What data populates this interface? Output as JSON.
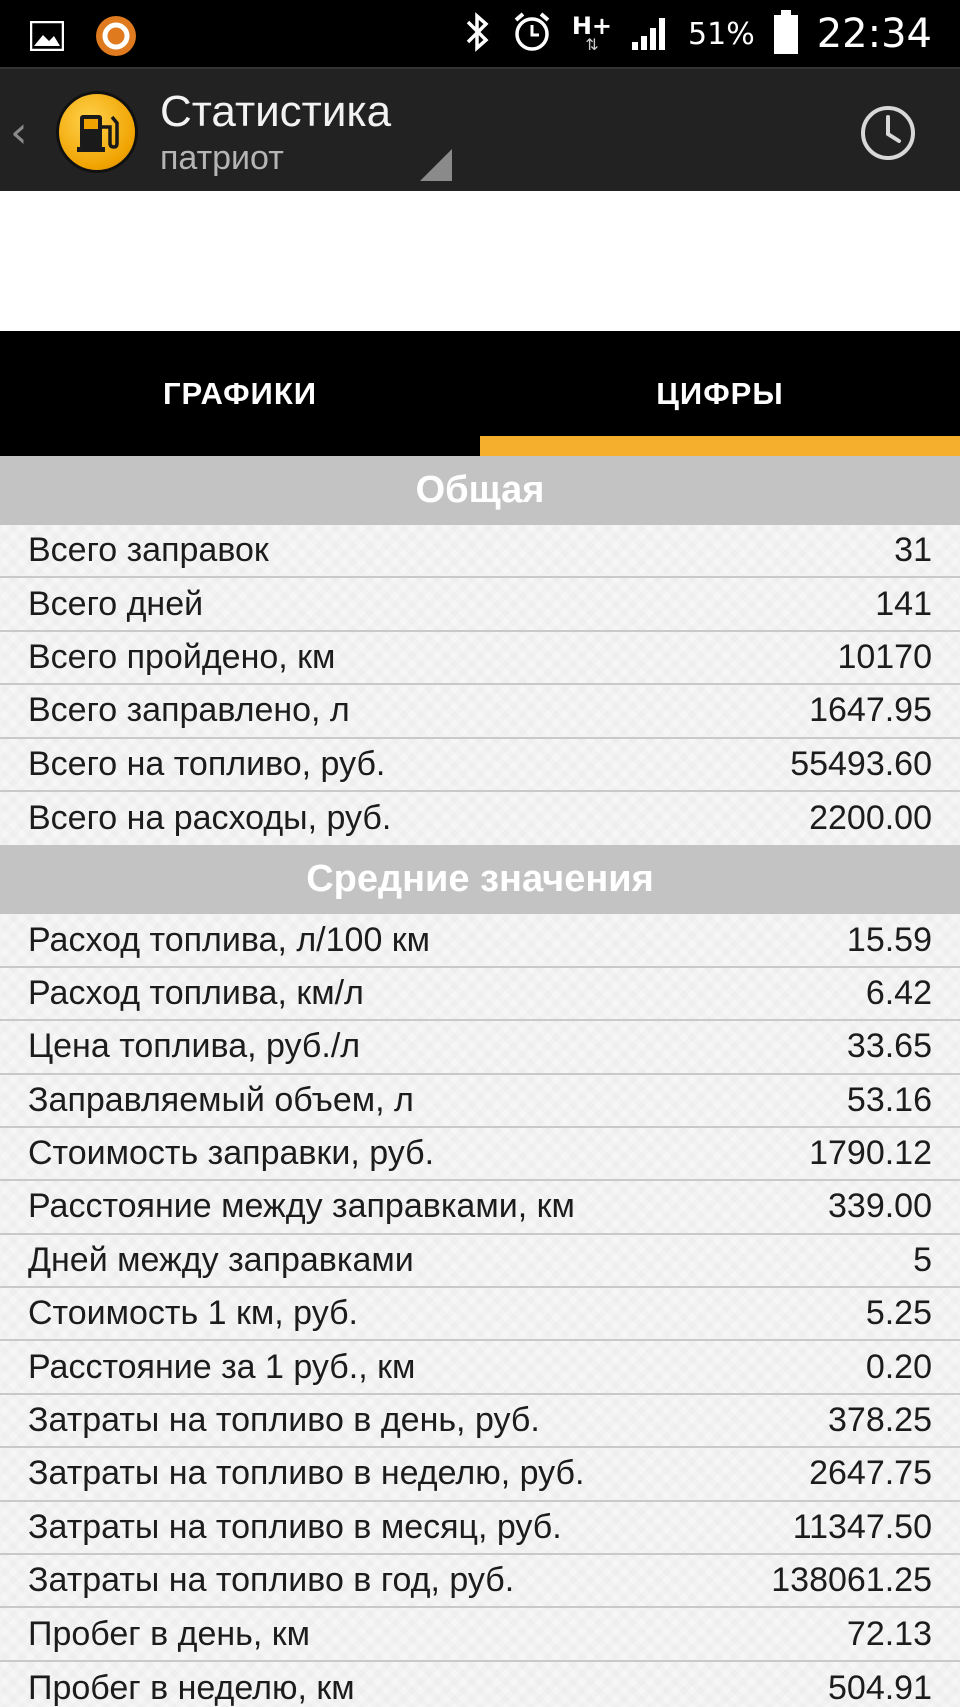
{
  "status_bar": {
    "network": "H+",
    "battery_percent": "51%",
    "time": "22:34",
    "icons": [
      "image-icon",
      "notification-app-icon",
      "bluetooth-icon",
      "alarm-icon",
      "network-h-plus-icon",
      "signal-icon",
      "battery-icon"
    ]
  },
  "action_bar": {
    "title": "Статистика",
    "subtitle": "патриот",
    "back_glyph": "‹",
    "accent": "#f6ae2d"
  },
  "tabs": [
    {
      "label": "ГРАФИКИ",
      "selected": false
    },
    {
      "label": "ЦИФРЫ",
      "selected": true
    }
  ],
  "sections": [
    {
      "title": "Общая",
      "rows": [
        {
          "label": "Всего заправок",
          "value": "31"
        },
        {
          "label": "Всего дней",
          "value": "141"
        },
        {
          "label": "Всего пройдено, км",
          "value": "10170"
        },
        {
          "label": "Всего заправлено, л",
          "value": "1647.95"
        },
        {
          "label": "Всего на топливо, руб.",
          "value": "55493.60"
        },
        {
          "label": "Всего на расходы, руб.",
          "value": "2200.00"
        }
      ]
    },
    {
      "title": "Средние значения",
      "rows": [
        {
          "label": "Расход топлива, л/100 км",
          "value": "15.59"
        },
        {
          "label": "Расход топлива, км/л",
          "value": "6.42"
        },
        {
          "label": "Цена топлива, руб./л",
          "value": "33.65"
        },
        {
          "label": "Заправляемый объем, л",
          "value": "53.16"
        },
        {
          "label": "Стоимость заправки, руб.",
          "value": "1790.12"
        },
        {
          "label": "Расстояние между заправками, км",
          "value": "339.00"
        },
        {
          "label": "Дней между заправками",
          "value": "5"
        },
        {
          "label": "Стоимость 1 км, руб.",
          "value": "5.25"
        },
        {
          "label": "Расстояние за 1 руб., км",
          "value": "0.20"
        },
        {
          "label": "Затраты на топливо в день, руб.",
          "value": "378.25"
        },
        {
          "label": "Затраты на топливо в неделю, руб.",
          "value": "2647.75"
        },
        {
          "label": "Затраты на топливо в месяц, руб.",
          "value": "11347.50"
        },
        {
          "label": "Затраты на топливо в год, руб.",
          "value": "138061.25"
        },
        {
          "label": "Пробег в день, км",
          "value": "72.13"
        },
        {
          "label": "Пробег в неделю, км",
          "value": "504.91"
        }
      ]
    }
  ]
}
